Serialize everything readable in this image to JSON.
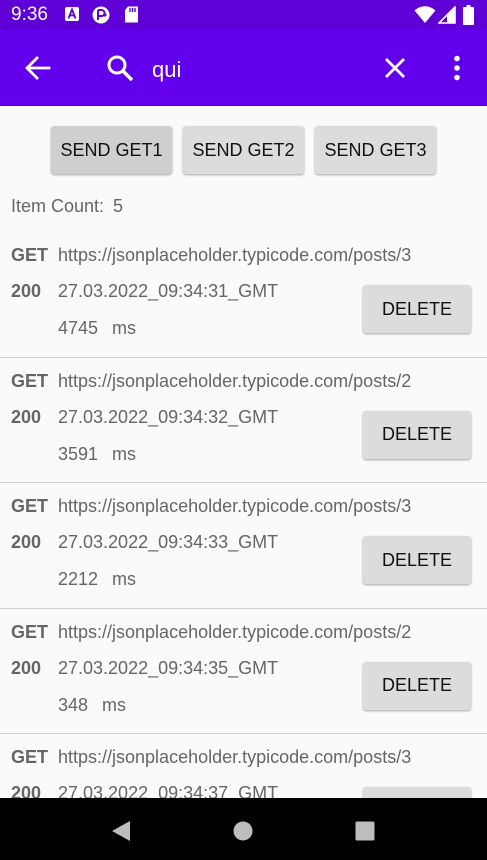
{
  "status_bar": {
    "time": "9:36",
    "icons": [
      "a-notification-icon",
      "app-notification-icon",
      "sd-card-icon",
      "wifi-icon",
      "signal-icon",
      "battery-icon"
    ]
  },
  "app_bar": {
    "search_value": "qui",
    "icons": [
      "back-arrow-icon",
      "search-icon",
      "clear-icon",
      "more-vert-icon"
    ],
    "color": "#6200ee"
  },
  "buttons": {
    "get1": "SEND GET1",
    "get2": "SEND GET2",
    "get3": "SEND GET3"
  },
  "item_count": {
    "label": "Item Count:",
    "value": "5"
  },
  "items": [
    {
      "method": "GET",
      "url": "https://jsonplaceholder.typicode.com/posts/3",
      "status": "200",
      "timestamp": "27.03.2022_09:34:31_GMT",
      "duration": "4745",
      "unit": "ms",
      "delete_label": "DELETE"
    },
    {
      "method": "GET",
      "url": "https://jsonplaceholder.typicode.com/posts/2",
      "status": "200",
      "timestamp": "27.03.2022_09:34:32_GMT",
      "duration": "3591",
      "unit": "ms",
      "delete_label": "DELETE"
    },
    {
      "method": "GET",
      "url": "https://jsonplaceholder.typicode.com/posts/3",
      "status": "200",
      "timestamp": "27.03.2022_09:34:33_GMT",
      "duration": "2212",
      "unit": "ms",
      "delete_label": "DELETE"
    },
    {
      "method": "GET",
      "url": "https://jsonplaceholder.typicode.com/posts/2",
      "status": "200",
      "timestamp": "27.03.2022_09:34:35_GMT",
      "duration": "348",
      "unit": "ms",
      "delete_label": "DELETE"
    },
    {
      "method": "GET",
      "url": "https://jsonplaceholder.typicode.com/posts/3",
      "status": "200",
      "timestamp": "27.03.2022_09:34:37_GMT",
      "duration": "",
      "unit": "",
      "delete_label": ""
    }
  ],
  "nav_bar": {
    "icons": [
      "nav-back-icon",
      "nav-home-icon",
      "nav-recents-icon"
    ]
  }
}
